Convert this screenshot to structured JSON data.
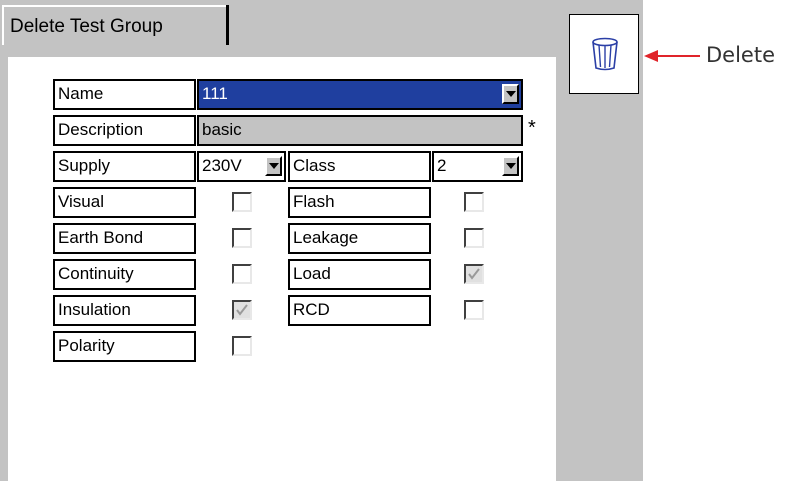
{
  "tab": {
    "title": "Delete Test Group"
  },
  "form": {
    "name": {
      "label": "Name",
      "value": "111"
    },
    "description": {
      "label": "Description",
      "value": "basic",
      "required_marker": "*"
    },
    "supply": {
      "label": "Supply",
      "value": "230V"
    },
    "class": {
      "label": "Class",
      "value": "2"
    }
  },
  "tests_left": [
    {
      "label": "Visual",
      "checked": false
    },
    {
      "label": "Earth Bond",
      "checked": false
    },
    {
      "label": "Continuity",
      "checked": false
    },
    {
      "label": "Insulation",
      "checked": true
    },
    {
      "label": "Polarity",
      "checked": false
    }
  ],
  "tests_right": [
    {
      "label": "Flash",
      "checked": false
    },
    {
      "label": "Leakage",
      "checked": false
    },
    {
      "label": "Load",
      "checked": true
    },
    {
      "label": "RCD",
      "checked": false
    }
  ],
  "delete_button": {
    "icon": "trash-icon"
  },
  "callout": {
    "label": "Delete"
  },
  "colors": {
    "selection_blue": "#1f3f9f",
    "panel_gray": "#c3c3c3",
    "callout_red": "#e0242a"
  }
}
